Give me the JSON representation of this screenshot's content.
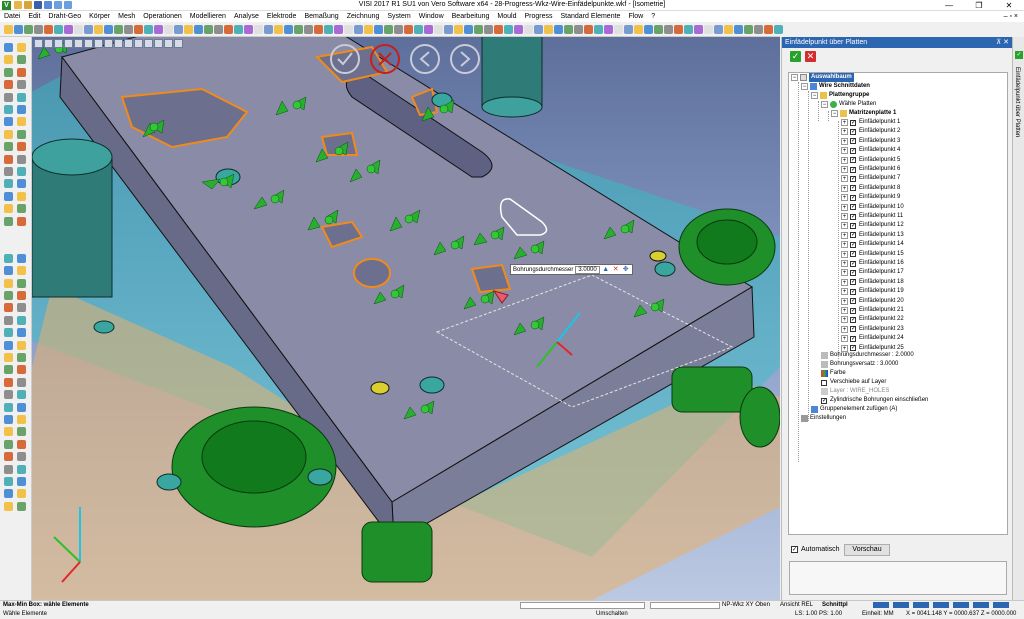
{
  "window": {
    "title": "VISI 2017 R1 SU1 von Vero Software x64 - 28-Progress-Wkz-Wire-Einfädelpunkte.wkf - [Isometrie]",
    "controls": [
      "—",
      "❐",
      "✕"
    ]
  },
  "menu": {
    "items": [
      "Datei",
      "Edit",
      "Draht-Geo",
      "Körper",
      "Mesh",
      "Operationen",
      "Modellieren",
      "Analyse",
      "Elektrode",
      "Bemaßung",
      "Zeichnung",
      "System",
      "Window",
      "Bearbeitung",
      "Mould",
      "Progress",
      "Standard Elemente",
      "Flow",
      "?"
    ],
    "right": "– ▫ ×"
  },
  "viewport": {
    "tooltip": {
      "label": "Bohrungsdurchmesser",
      "value": "3.0000"
    }
  },
  "panel": {
    "title": "Einfädelpunkt über Platten",
    "pin": "⊼ ✕",
    "tree": {
      "root": "Auswahlbaum",
      "wire_data": "Wire Schnittdaten",
      "plate_group": "Plattengruppe",
      "select_plates": "Wähle Platten",
      "plate": "Matritzenplatte 1",
      "points": [
        "Einfädelpunkt 1",
        "Einfädelpunkt 2",
        "Einfädelpunkt 3",
        "Einfädelpunkt 4",
        "Einfädelpunkt 5",
        "Einfädelpunkt 6",
        "Einfädelpunkt 7",
        "Einfädelpunkt 8",
        "Einfädelpunkt 9",
        "Einfädelpunkt 10",
        "Einfädelpunkt 11",
        "Einfädelpunkt 12",
        "Einfädelpunkt 13",
        "Einfädelpunkt 14",
        "Einfädelpunkt 15",
        "Einfädelpunkt 16",
        "Einfädelpunkt 17",
        "Einfädelpunkt 18",
        "Einfädelpunkt 19",
        "Einfädelpunkt 20",
        "Einfädelpunkt 21",
        "Einfädelpunkt 22",
        "Einfädelpunkt 23",
        "Einfädelpunkt 24",
        "Einfädelpunkt 25"
      ],
      "bore_diameter": "Bohrungsdurchmesser : 2.0000",
      "bore_offset": "Bohrungsversatz : 3.0000",
      "color": "Farbe",
      "move_to_layer": "Verschiebe auf Layer",
      "layer": "Layer : WIRE_HOLES",
      "cylindrical": "Zylindrische Bohrungen einschließen",
      "add_group_element": "Gruppenelement zufügen (A)",
      "settings": "Einstellungen"
    },
    "automatic_label": "Automatisch",
    "preview_label": "Vorschau"
  },
  "side_tab": {
    "label": "Einfädelpunkt über Platten"
  },
  "status": {
    "line1": "Max-Min Box: wähle Elemente",
    "line2": "Wähle Elemente",
    "umschalten": "Umschalten",
    "plane": "NP-Wkz XY Oben",
    "view": "Ansicht REL",
    "mode": "Schnittpl",
    "scale": "LS: 1.00 PS: 1.00",
    "unit": "Einheit: MM",
    "coords": "X = 0041.148 Y = 0000.637 Z = 0000.000"
  },
  "colors": {
    "accent": "#2c65b0",
    "ok": "#27a32b",
    "cancel": "#d42d2d",
    "plate": "#7d7e99",
    "green_parts": "#1f8f2a",
    "cyan_parts": "#22a7a5"
  }
}
